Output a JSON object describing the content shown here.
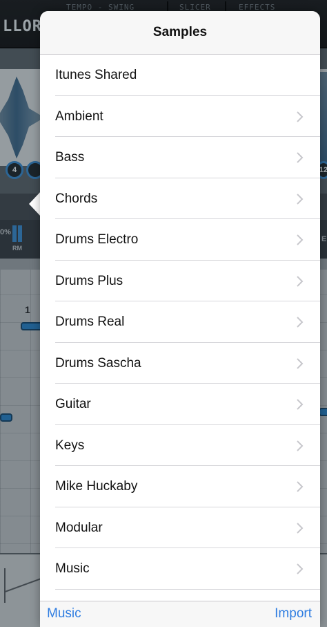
{
  "background": {
    "logo_text": "LLOR",
    "topbar_chips": [
      "TEMPO - SWING",
      "SLICER",
      "EFFECTS"
    ],
    "knob_left": "4",
    "knob_right": "12",
    "percent_label": "0%",
    "rm_label": "RM",
    "e_label": "E",
    "seq_number": "1"
  },
  "popover": {
    "title": "Samples",
    "items": [
      {
        "label": "Itunes Shared",
        "has_chevron": false
      },
      {
        "label": "Ambient",
        "has_chevron": true
      },
      {
        "label": "Bass",
        "has_chevron": true
      },
      {
        "label": "Chords",
        "has_chevron": true
      },
      {
        "label": "Drums Electro",
        "has_chevron": true
      },
      {
        "label": "Drums Plus",
        "has_chevron": true
      },
      {
        "label": "Drums Real",
        "has_chevron": true
      },
      {
        "label": "Drums Sascha",
        "has_chevron": true
      },
      {
        "label": "Guitar",
        "has_chevron": true
      },
      {
        "label": "Keys",
        "has_chevron": true
      },
      {
        "label": "Mike Huckaby",
        "has_chevron": true
      },
      {
        "label": "Modular",
        "has_chevron": true
      },
      {
        "label": "Music",
        "has_chevron": true
      }
    ],
    "toolbar": {
      "left_label": "Music",
      "right_label": "Import"
    }
  },
  "colors": {
    "accent": "#2f7de1",
    "chevron": "#c7c7cc"
  },
  "icons": {
    "chevron": "chevron-right-icon"
  }
}
